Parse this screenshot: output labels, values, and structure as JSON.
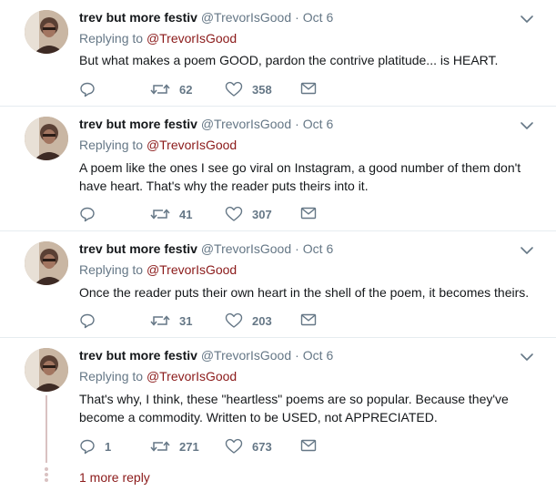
{
  "tweets": [
    {
      "name": "trev but more festiv",
      "handle": "@TrevorIsGood",
      "date": "Oct 6",
      "replying_prefix": "Replying to",
      "replying_to": "@TrevorIsGood",
      "text": "But what makes a poem GOOD, pardon the contrive platitude... is HEART.",
      "replies": "",
      "retweets": "62",
      "likes": "358"
    },
    {
      "name": "trev but more festiv",
      "handle": "@TrevorIsGood",
      "date": "Oct 6",
      "replying_prefix": "Replying to",
      "replying_to": "@TrevorIsGood",
      "text": "A poem like the ones I see go viral on Instagram, a good number of them don't have heart. That's why the reader puts theirs into it.",
      "replies": "",
      "retweets": "41",
      "likes": "307"
    },
    {
      "name": "trev but more festiv",
      "handle": "@TrevorIsGood",
      "date": "Oct 6",
      "replying_prefix": "Replying to",
      "replying_to": "@TrevorIsGood",
      "text": "Once the reader puts their own heart in the shell of the poem, it becomes theirs.",
      "replies": "",
      "retweets": "31",
      "likes": "203"
    },
    {
      "name": "trev but more festiv",
      "handle": "@TrevorIsGood",
      "date": "Oct 6",
      "replying_prefix": "Replying to",
      "replying_to": "@TrevorIsGood",
      "text": "That's why, I think, these \"heartless\" poems are so popular. Because they've become a commodity. Written to be USED, not APPRECIATED.",
      "replies": "1",
      "retweets": "271",
      "likes": "673"
    }
  ],
  "more_replies": "1 more reply",
  "icons": {
    "reply": "reply-icon",
    "retweet": "retweet-icon",
    "like": "heart-icon",
    "dm": "envelope-icon",
    "menu": "chevron-down-icon"
  },
  "colors": {
    "link": "#8b1a1a",
    "secondary": "#657786",
    "thread_line": "#d9c2c2"
  }
}
